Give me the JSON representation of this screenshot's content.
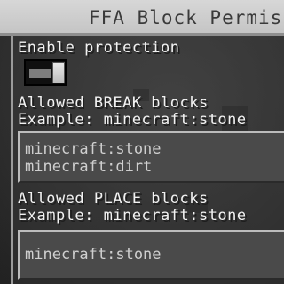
{
  "window": {
    "title": "FFA Block Permissions"
  },
  "form": {
    "protection": {
      "label": "Enable protection",
      "enabled": true
    },
    "break_blocks": {
      "label": "Allowed BREAK blocks",
      "hint": "Example: minecraft:stone",
      "values": [
        "minecraft:stone",
        "minecraft:dirt"
      ]
    },
    "place_blocks": {
      "label": "Allowed PLACE blocks",
      "hint": "Example: minecraft:stone",
      "values": [
        "minecraft:stone"
      ]
    }
  },
  "colors": {
    "title_bar": "#cfcfcf",
    "text": "#f2f2f2",
    "field_bg": "#4a4a4a"
  }
}
